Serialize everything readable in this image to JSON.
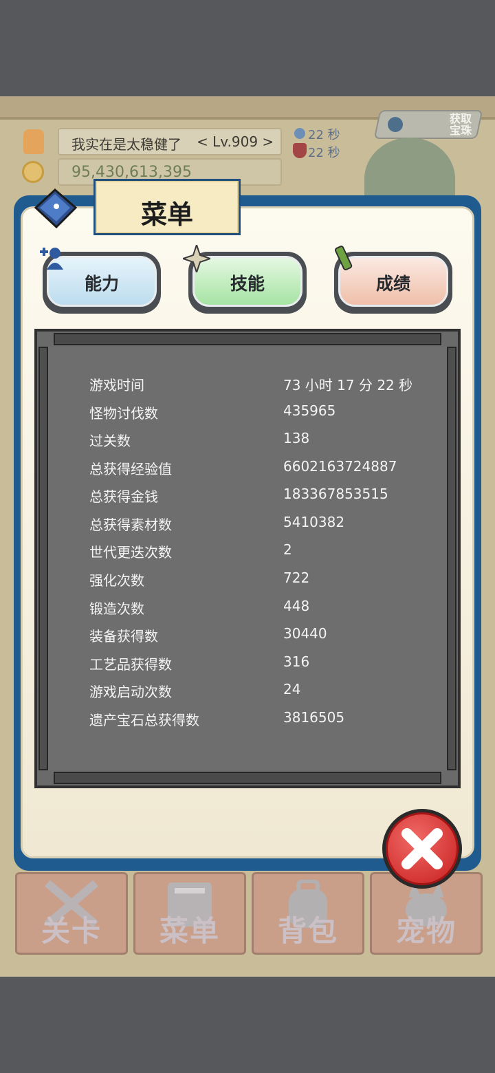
{
  "hud": {
    "player_name": "我实在是太稳健了",
    "level": "< Lv.909 >",
    "gold": "95,430,613,395",
    "timer_1": "22 秒",
    "timer_2": "22 秒",
    "obtain_button": "获取\n宝珠"
  },
  "menu": {
    "title": "菜单",
    "tabs": [
      {
        "label": "能力",
        "color": "#cfe7f3",
        "icon": "person-plus-icon"
      },
      {
        "label": "技能",
        "color": "#c9efc6",
        "icon": "sparkle-icon"
      },
      {
        "label": "成绩",
        "color": "#f4d7ca",
        "icon": "pencil-icon"
      }
    ]
  },
  "stats": [
    {
      "label": "游戏时间",
      "value": "73 小时 17 分 22 秒"
    },
    {
      "label": "怪物讨伐数",
      "value": "435965"
    },
    {
      "label": "过关数",
      "value": "138"
    },
    {
      "label": "总获得经验值",
      "value": "6602163724887"
    },
    {
      "label": "总获得金钱",
      "value": "183367853515"
    },
    {
      "label": "总获得素材数",
      "value": "5410382"
    },
    {
      "label": "世代更迭次数",
      "value": "2"
    },
    {
      "label": "强化次数",
      "value": "722"
    },
    {
      "label": "锻造次数",
      "value": "448"
    },
    {
      "label": "装备获得数",
      "value": "30440"
    },
    {
      "label": "工艺品获得数",
      "value": "316"
    },
    {
      "label": "游戏启动次数",
      "value": "24"
    },
    {
      "label": "遗产宝石总获得数",
      "value": "3816505"
    }
  ],
  "nav": [
    {
      "label": "关卡",
      "icon": "crossed-swords-icon"
    },
    {
      "label": "菜单",
      "icon": "book-icon"
    },
    {
      "label": "背包",
      "icon": "backpack-icon"
    },
    {
      "label": "宠物",
      "icon": "pet-icon"
    }
  ],
  "colors": {
    "panel_border": "#1f5b8e",
    "board": "#6e6e6e",
    "close": "#d62a2a"
  }
}
